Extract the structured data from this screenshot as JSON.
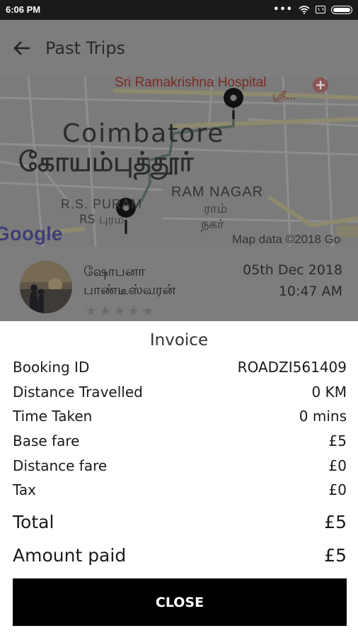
{
  "status_bar": {
    "time": "6:06 PM",
    "icons": [
      "more-dots-icon",
      "wifi-icon",
      "sim-icon",
      "battery-icon"
    ]
  },
  "header": {
    "back_icon": "arrow-left-icon",
    "title": "Past Trips"
  },
  "map": {
    "labels": {
      "hospital": "Sri Ramakrishna Hospital",
      "hospital_ta": "ஸ்ரீ...",
      "city_en": "Coimbatore",
      "city_ta": "கோயம்புத்தூர்",
      "area1_en": "R.S. PURAM",
      "area1_ta": "RS புரம்",
      "area2_en": "RAM NAGAR",
      "area2_ta_line1": "ராம்",
      "area2_ta_line2": "நகர்",
      "google": "Google",
      "attribution": "Map data ©2018 Go"
    }
  },
  "trip": {
    "driver_name": "ஷோபனா பாண்டீஸ்வரன்",
    "date": "05th Dec 2018",
    "time": "10:47 AM",
    "rating_stars": "★★★★★"
  },
  "invoice": {
    "title": "Invoice",
    "rows": [
      {
        "label": "Booking ID",
        "value": "ROADZI561409"
      },
      {
        "label": "Distance Travelled",
        "value": "0 KM"
      },
      {
        "label": "Time Taken",
        "value": "0 mins"
      },
      {
        "label": "Base fare",
        "value": "£5"
      },
      {
        "label": "Distance fare",
        "value": "£0"
      },
      {
        "label": "Tax",
        "value": "£0"
      }
    ],
    "total": {
      "label": "Total",
      "value": "£5"
    },
    "amount_paid": {
      "label": "Amount paid",
      "value": "£5"
    },
    "close_label": "CLOSE"
  }
}
